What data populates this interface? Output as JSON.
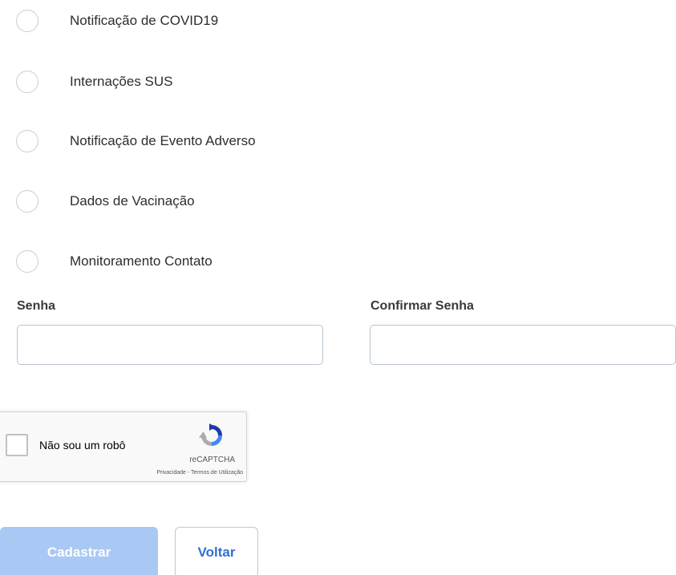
{
  "radio_options": [
    {
      "label": "Notificação de COVID19"
    },
    {
      "label": "Internações SUS"
    },
    {
      "label": "Notificação de Evento Adverso"
    },
    {
      "label": "Dados de Vacinação"
    },
    {
      "label": "Monitoramento Contato"
    }
  ],
  "password": {
    "label": "Senha",
    "value": "",
    "placeholder": ""
  },
  "confirm_password": {
    "label": "Confirmar Senha",
    "value": "",
    "placeholder": ""
  },
  "captcha": {
    "text": "Não sou um robô",
    "brand": "reCAPTCHA",
    "links": "Privacidade - Termos de Utilização"
  },
  "buttons": {
    "submit_label": "Cadastrar",
    "back_label": "Voltar"
  },
  "colors": {
    "primary_button": "#a9c8f4",
    "link_blue": "#2f6fd6",
    "input_border": "#b9c4cf"
  }
}
